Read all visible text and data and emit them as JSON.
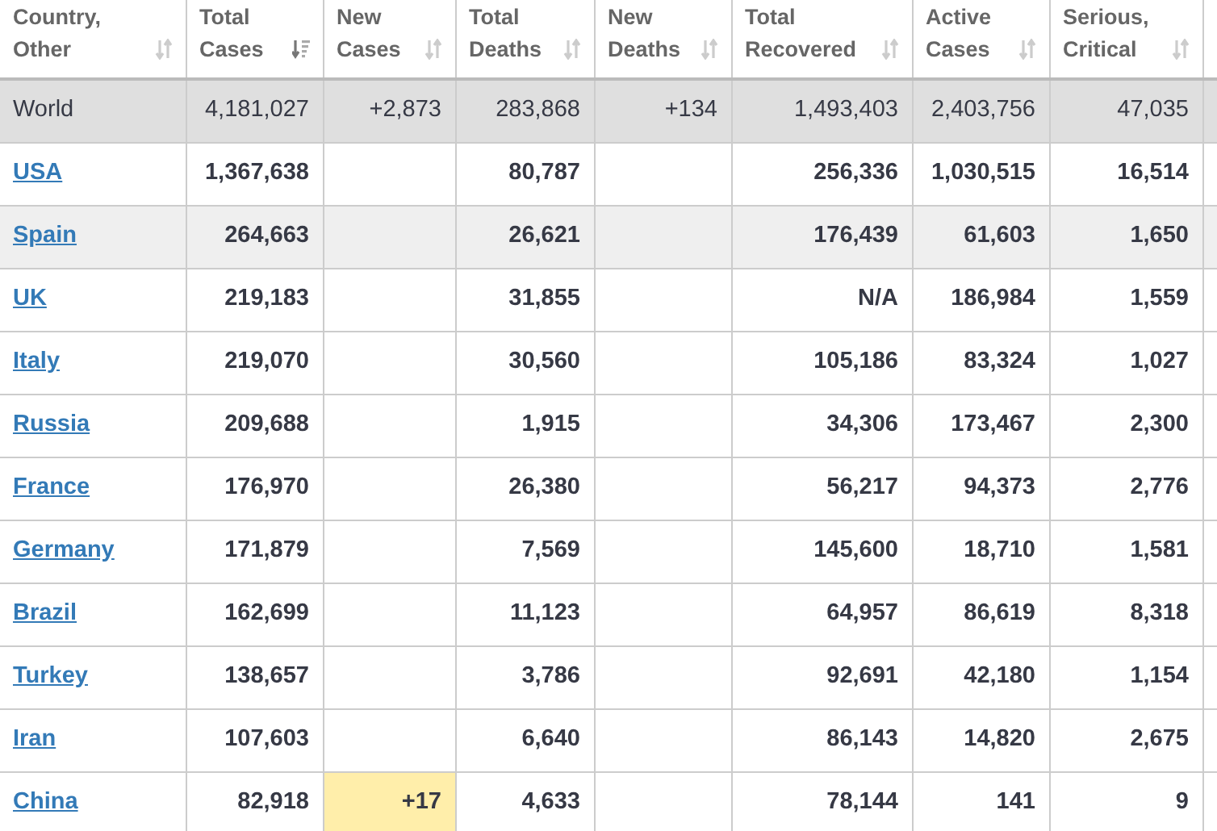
{
  "table": {
    "columns": [
      {
        "label": "Country, Other",
        "sorted": false
      },
      {
        "label": "Total Cases",
        "sorted": true
      },
      {
        "label": "New Cases",
        "sorted": false
      },
      {
        "label": "Total Deaths",
        "sorted": false
      },
      {
        "label": "New Deaths",
        "sorted": false
      },
      {
        "label": "Total Recovered",
        "sorted": false
      },
      {
        "label": "Active Cases",
        "sorted": false
      },
      {
        "label": "Serious, Critical",
        "sorted": false
      }
    ],
    "rows": [
      {
        "kind": "total",
        "new_cases_highlighted": false,
        "cells": [
          "World",
          "4,181,027",
          "+2,873",
          "283,868",
          "+134",
          "1,493,403",
          "2,403,756",
          "47,035"
        ]
      },
      {
        "kind": "country",
        "hovered": false,
        "new_cases_highlighted": false,
        "cells": [
          "USA",
          "1,367,638",
          null,
          "80,787",
          null,
          "256,336",
          "1,030,515",
          "16,514"
        ]
      },
      {
        "kind": "country",
        "hovered": true,
        "new_cases_highlighted": false,
        "cells": [
          "Spain",
          "264,663",
          null,
          "26,621",
          null,
          "176,439",
          "61,603",
          "1,650"
        ]
      },
      {
        "kind": "country",
        "hovered": false,
        "new_cases_highlighted": false,
        "cells": [
          "UK",
          "219,183",
          null,
          "31,855",
          null,
          "N/A",
          "186,984",
          "1,559"
        ]
      },
      {
        "kind": "country",
        "hovered": false,
        "new_cases_highlighted": false,
        "cells": [
          "Italy",
          "219,070",
          null,
          "30,560",
          null,
          "105,186",
          "83,324",
          "1,027"
        ]
      },
      {
        "kind": "country",
        "hovered": false,
        "new_cases_highlighted": false,
        "cells": [
          "Russia",
          "209,688",
          null,
          "1,915",
          null,
          "34,306",
          "173,467",
          "2,300"
        ]
      },
      {
        "kind": "country",
        "hovered": false,
        "new_cases_highlighted": false,
        "cells": [
          "France",
          "176,970",
          null,
          "26,380",
          null,
          "56,217",
          "94,373",
          "2,776"
        ]
      },
      {
        "kind": "country",
        "hovered": false,
        "new_cases_highlighted": false,
        "cells": [
          "Germany",
          "171,879",
          null,
          "7,569",
          null,
          "145,600",
          "18,710",
          "1,581"
        ]
      },
      {
        "kind": "country",
        "hovered": false,
        "new_cases_highlighted": false,
        "cells": [
          "Brazil",
          "162,699",
          null,
          "11,123",
          null,
          "64,957",
          "86,619",
          "8,318"
        ]
      },
      {
        "kind": "country",
        "hovered": false,
        "new_cases_highlighted": false,
        "cells": [
          "Turkey",
          "138,657",
          null,
          "3,786",
          null,
          "92,691",
          "42,180",
          "1,154"
        ]
      },
      {
        "kind": "country",
        "hovered": false,
        "new_cases_highlighted": false,
        "cells": [
          "Iran",
          "107,603",
          null,
          "6,640",
          null,
          "86,143",
          "14,820",
          "2,675"
        ]
      },
      {
        "kind": "country",
        "hovered": false,
        "new_cases_highlighted": true,
        "cells": [
          "China",
          "82,918",
          "+17",
          "4,633",
          null,
          "78,144",
          "141",
          "9"
        ]
      }
    ]
  }
}
